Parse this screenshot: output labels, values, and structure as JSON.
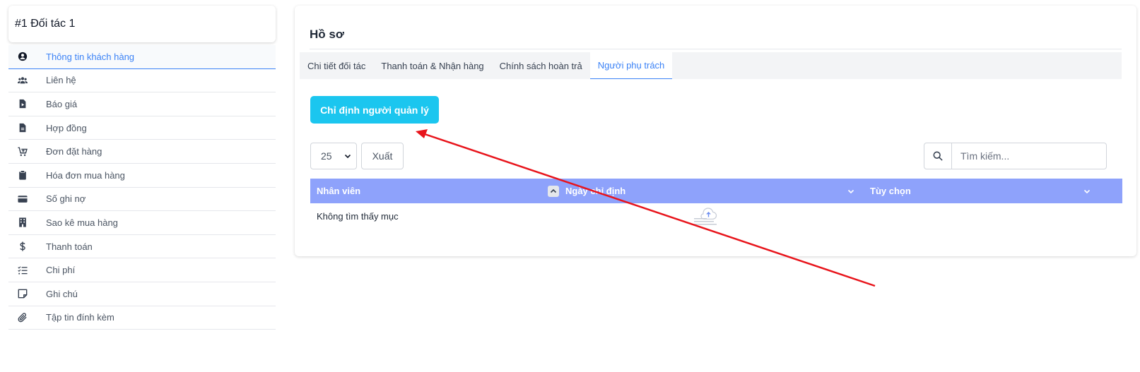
{
  "client": {
    "title": "#1 Đối tác 1"
  },
  "sidebar": {
    "items": [
      {
        "label": "Thông tin khách hàng",
        "icon": "user-circle-icon",
        "active": true
      },
      {
        "label": "Liên hệ",
        "icon": "users-icon"
      },
      {
        "label": "Báo giá",
        "icon": "file-play-icon"
      },
      {
        "label": "Hợp đồng",
        "icon": "file-text-icon"
      },
      {
        "label": "Đơn đặt hàng",
        "icon": "cart-plus-icon"
      },
      {
        "label": "Hóa đơn mua hàng",
        "icon": "clipboard-icon"
      },
      {
        "label": "Số ghi nợ",
        "icon": "credit-card-icon"
      },
      {
        "label": "Sao kê mua hàng",
        "icon": "building-icon"
      },
      {
        "label": "Thanh toán",
        "icon": "dollar-icon"
      },
      {
        "label": "Chi phí",
        "icon": "checklist-icon"
      },
      {
        "label": "Ghi chú",
        "icon": "sticky-note-icon"
      },
      {
        "label": "Tập tin đính kèm",
        "icon": "paperclip-icon"
      }
    ]
  },
  "main": {
    "title": "Hồ sơ",
    "tabs": [
      {
        "label": "Chi tiết đối tác"
      },
      {
        "label": "Thanh toán & Nhận hàng"
      },
      {
        "label": "Chính sách hoàn trả"
      },
      {
        "label": "Người phụ trách",
        "active": true
      }
    ],
    "assign_button": "Chỉ định người quản lý",
    "page_size": "25",
    "export_label": "Xuất",
    "search_placeholder": "Tìm kiếm...",
    "table": {
      "columns": [
        "Nhân viên",
        "Ngày chỉ định",
        "Tùy chọn"
      ],
      "empty_text": "Không tìm thấy mục"
    }
  },
  "colors": {
    "accent": "#3b82f6",
    "button": "#1bc6ef",
    "table_header": "#8ea2fb",
    "annotation": "#e8141b"
  }
}
